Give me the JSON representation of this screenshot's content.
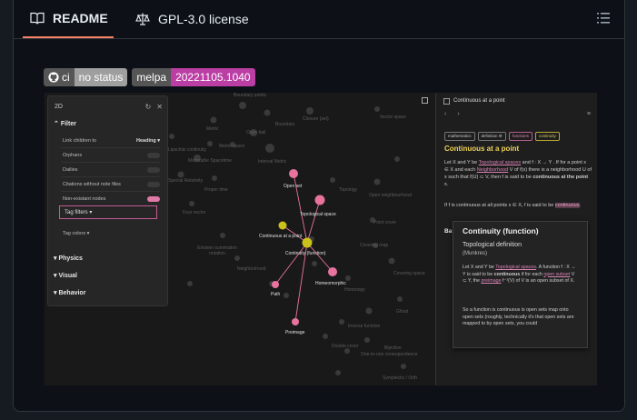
{
  "tabs": {
    "readme": "README",
    "license": "GPL-3.0 license"
  },
  "badges": {
    "ci": {
      "label": "ci",
      "status": "no status"
    },
    "melpa": {
      "label": "melpa",
      "version": "20221105.1040"
    }
  },
  "screenshot": {
    "panel": {
      "title": "2D",
      "filter": "Filter",
      "link_children_to": "Link children to",
      "link_children_value": "Heading",
      "orphans": "Orphans",
      "dailies": "Dailies",
      "citations": "Citations without note files",
      "non_existant": "Non-existant nodes",
      "tag_filters": "Tag filters",
      "tag_colors": "Tag colors",
      "physics": "Physics",
      "visual": "Visual",
      "behavior": "Behavior"
    },
    "graph_nodes": {
      "open_set": "Open set",
      "topological_space": "Topological space",
      "continuous_at_a_point": "Continuous at a point",
      "continuity_function": "Continuity (function)",
      "homeomorphic": "Homeomorphic",
      "path": "Path",
      "preimage": "Preimage"
    },
    "graph_background": {
      "boundary_points": "Boundary points",
      "metric": "Metric",
      "open_ball": "Open ball",
      "closure": "Closure (set)",
      "vector_space": "Vector space",
      "boundary": "Boundary",
      "metric_space": "Metric space",
      "interval_metric": "Interval Metric",
      "metrizable": "Metrizable Spacetime",
      "lipschitz": "Lipschitz continuity",
      "special_relativity": "Special Relativity",
      "proper_time": "Proper time",
      "topology": "Topology",
      "open_neighbourhood": "Open neighbourhood",
      "four_vector": "Four vector",
      "point_cover": "Point cover",
      "einstein": "Einstein summation notation",
      "covering_map": "Covering map",
      "neighborhood": "Neighborhood",
      "covering_space": "Covering space",
      "homotopy": "Homotopy",
      "ghost": "Ghost",
      "inverse_function": "Inverse function",
      "double_cover": "Double cover",
      "bijective": "Bijective",
      "one_to_one": "One-to-one correspondence",
      "symplectic": "Symplectic / Orth"
    },
    "note": {
      "header": "Continuous at a point",
      "nav_back": "‹",
      "nav_fwd": "›",
      "nav_menu": "≡",
      "chips": [
        "mathematics",
        "definition ⚙",
        "functions",
        "continuity"
      ],
      "title": "Continuous at a point",
      "p1_a": "Let X and Y be ",
      "p1_link1": "Topological spaces",
      "p1_b": " and f : X → Y . If for a point x ∈ X and each ",
      "p1_link2": "Neighborhood",
      "p1_c": " V of f(x) there is a neighborhood U of x such that f(U) ⊂ V, then f is said to be ",
      "p1_bold": "continuous at the point",
      "p1_d": " x.",
      "p2_a": "If f is continuous at all points x ∈ X, f is said to be ",
      "p2_link": "continuous",
      "p2_b": ".",
      "ba": "Ba"
    },
    "popup": {
      "title": "Continuity (function)",
      "subtitle": "Topological definition",
      "meta": "(Munkres)",
      "p1_a": "Let X and Y be ",
      "p1_link": "Topological spaces",
      "p1_b": ". A function f : X → Y is said to be ",
      "p1_bold": "continuous",
      "p1_c": " if for each ",
      "p1_link2": "open subset",
      "p1_d": " V ⊂ Y, the ",
      "p1_link3": "preimage",
      "p1_e": " f⁻¹(V) of V is an open subset of X.",
      "p2": "So a function is continuous is open sets map onto open sets (roughly, technically it's that open sets are mapped to by open sets, you could"
    }
  },
  "colors": {
    "accent_tab": "#f78166",
    "node_pink": "#e8739f",
    "node_yellow": "#c8c21a",
    "badge_purple": "#bb3ea4"
  }
}
